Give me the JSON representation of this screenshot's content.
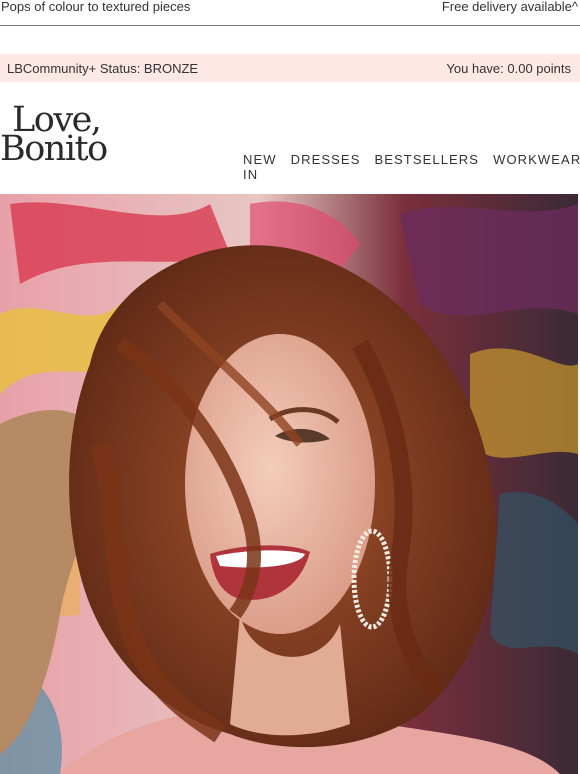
{
  "announcement": {
    "promo_text": "Pops of colour to textured pieces",
    "delivery_text": "Free delivery available^"
  },
  "membership": {
    "status_text": "LBCommunity+ Status: BRONZE",
    "points_text": "You have: 0.00 points"
  },
  "brand": {
    "logo_line1": "Love,",
    "logo_line2": "Bonito"
  },
  "nav": {
    "items": [
      "NEW IN",
      "DRESSES",
      "BESTSELLERS",
      "WORKWEAR"
    ]
  },
  "colors": {
    "status_bg": "#fde8e6",
    "text": "#333333"
  }
}
